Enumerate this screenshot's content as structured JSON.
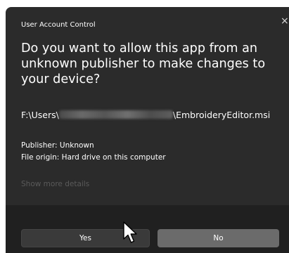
{
  "dialog": {
    "window_title": "User Account Control",
    "close_glyph": "×",
    "question": "Do you want to allow this app from an unknown publisher to make changes to your device?",
    "file_path_prefix": "F:\\Users\\",
    "file_path_suffix": "\\EmbroideryEditor.msi",
    "publisher": "Publisher: Unknown",
    "file_origin": "File origin: Hard drive on this computer",
    "show_more": "Show more details"
  },
  "buttons": {
    "yes": "Yes",
    "no": "No"
  },
  "colors": {
    "dialog_bg": "#2b2b2b",
    "footer_bg": "#202020",
    "no_button": "#6b6b6b",
    "yes_button": "#3a3a3a"
  },
  "icons": {
    "close": "close-icon",
    "cursor": "mouse-pointer-icon"
  }
}
